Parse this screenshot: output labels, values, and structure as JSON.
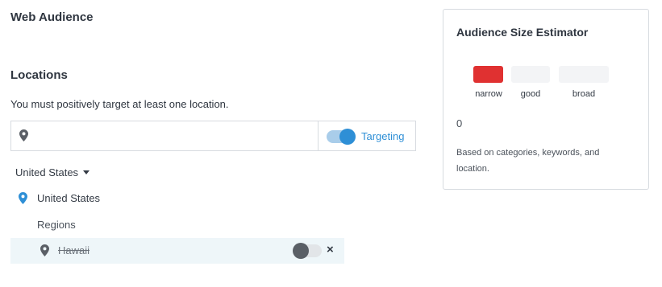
{
  "web_audience": {
    "title": "Web Audience"
  },
  "locations": {
    "title": "Locations",
    "helper_text": "You must positively target at least one location.",
    "search": {
      "value": "",
      "placeholder": ""
    },
    "targeting": {
      "label": "Targeting",
      "enabled": true
    },
    "country_dropdown": {
      "selected": "United States"
    },
    "selected_country": "United States",
    "regions_label": "Regions",
    "regions": [
      {
        "name": "Hawaii",
        "targeting": false,
        "excluded": true,
        "remove_icon": "×"
      }
    ]
  },
  "estimator": {
    "title": "Audience Size Estimator",
    "levels": [
      {
        "label": "narrow",
        "active": true
      },
      {
        "label": "good",
        "active": false
      },
      {
        "label": "broad",
        "active": false
      }
    ],
    "value": "0",
    "note": "Based on categories, keywords, and location.",
    "colors": {
      "active": "#e03131",
      "inactive": "#f3f4f6"
    }
  },
  "colors": {
    "accent": "#2e8fd6",
    "row_highlight": "#eef6f9"
  },
  "icons": {
    "location": "map-pin-icon",
    "remove": "close-icon",
    "dropdown": "caret-down-icon"
  }
}
